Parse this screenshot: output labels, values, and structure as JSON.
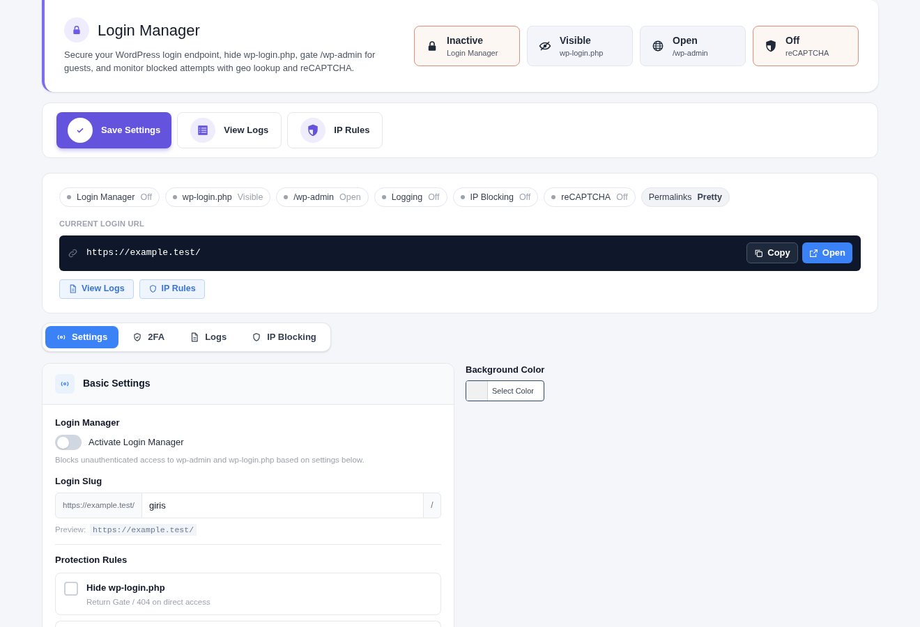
{
  "header": {
    "title": "Login Manager",
    "description": "Secure your WordPress login endpoint, hide wp-login.php, gate /wp-admin for guests, and monitor blocked attempts with geo lookup and reCAPTCHA."
  },
  "status_cards": [
    {
      "kind": "lock",
      "alert": true,
      "value": "Inactive",
      "label": "Login Manager"
    },
    {
      "kind": "eye",
      "alert": false,
      "value": "Visible",
      "label": "wp-login.php"
    },
    {
      "kind": "globe",
      "alert": false,
      "value": "Open",
      "label": "/wp-admin"
    },
    {
      "kind": "shield",
      "alert": true,
      "value": "Off",
      "label": "reCAPTCHA"
    }
  ],
  "actions": [
    {
      "kind": "check",
      "label": "Save Settings",
      "primary": true
    },
    {
      "kind": "list",
      "label": "View Logs",
      "primary": false
    },
    {
      "kind": "shield",
      "label": "IP Rules",
      "primary": false
    }
  ],
  "status_pills": [
    {
      "label": "Login Manager",
      "value": "Off",
      "dot": true
    },
    {
      "label": "wp-login.php",
      "value": "Visible",
      "dot": true
    },
    {
      "label": "/wp-admin",
      "value": "Open",
      "dot": true
    },
    {
      "label": "Logging",
      "value": "Off",
      "dot": true
    },
    {
      "label": "IP Blocking",
      "value": "Off",
      "dot": true
    },
    {
      "label": "reCAPTCHA",
      "value": "Off",
      "dot": true
    },
    {
      "label": "Permalinks",
      "value": "Pretty",
      "dot": false
    }
  ],
  "login_url": {
    "heading": "CURRENT LOGIN URL",
    "url": "https://example.test/",
    "copy": "Copy",
    "open": "Open"
  },
  "quick_links": [
    {
      "kind": "doc",
      "label": "View Logs"
    },
    {
      "kind": "shield",
      "label": "IP Rules"
    }
  ],
  "tabs": [
    {
      "kind": "radio",
      "label": "Settings",
      "selected": true
    },
    {
      "kind": "shield",
      "label": "2FA",
      "selected": false
    },
    {
      "kind": "doc",
      "label": "Logs",
      "selected": false
    },
    {
      "kind": "shield",
      "label": "IP Blocking",
      "selected": false
    }
  ],
  "basic_settings": {
    "title": "Basic Settings",
    "login_manager": {
      "heading": "Login Manager",
      "toggle_label": "Activate Login Manager",
      "on": false,
      "help": "Blocks unauthenticated access to wp-admin and wp-login.php based on settings below."
    },
    "login_slug": {
      "heading": "Login Slug",
      "prefix": "https://example.test/",
      "value": "giris",
      "suffix": "/",
      "preview_label": "Preview:",
      "preview": "https://example.test/"
    },
    "protection_rules": {
      "heading": "Protection Rules",
      "rules": [
        {
          "title": "Hide wp-login.php",
          "description": "Return Gate / 404 on direct access",
          "checked": false
        }
      ]
    }
  },
  "background_color": {
    "heading": "Background Color",
    "button": "Select Color",
    "color": "#f1f1f1"
  }
}
